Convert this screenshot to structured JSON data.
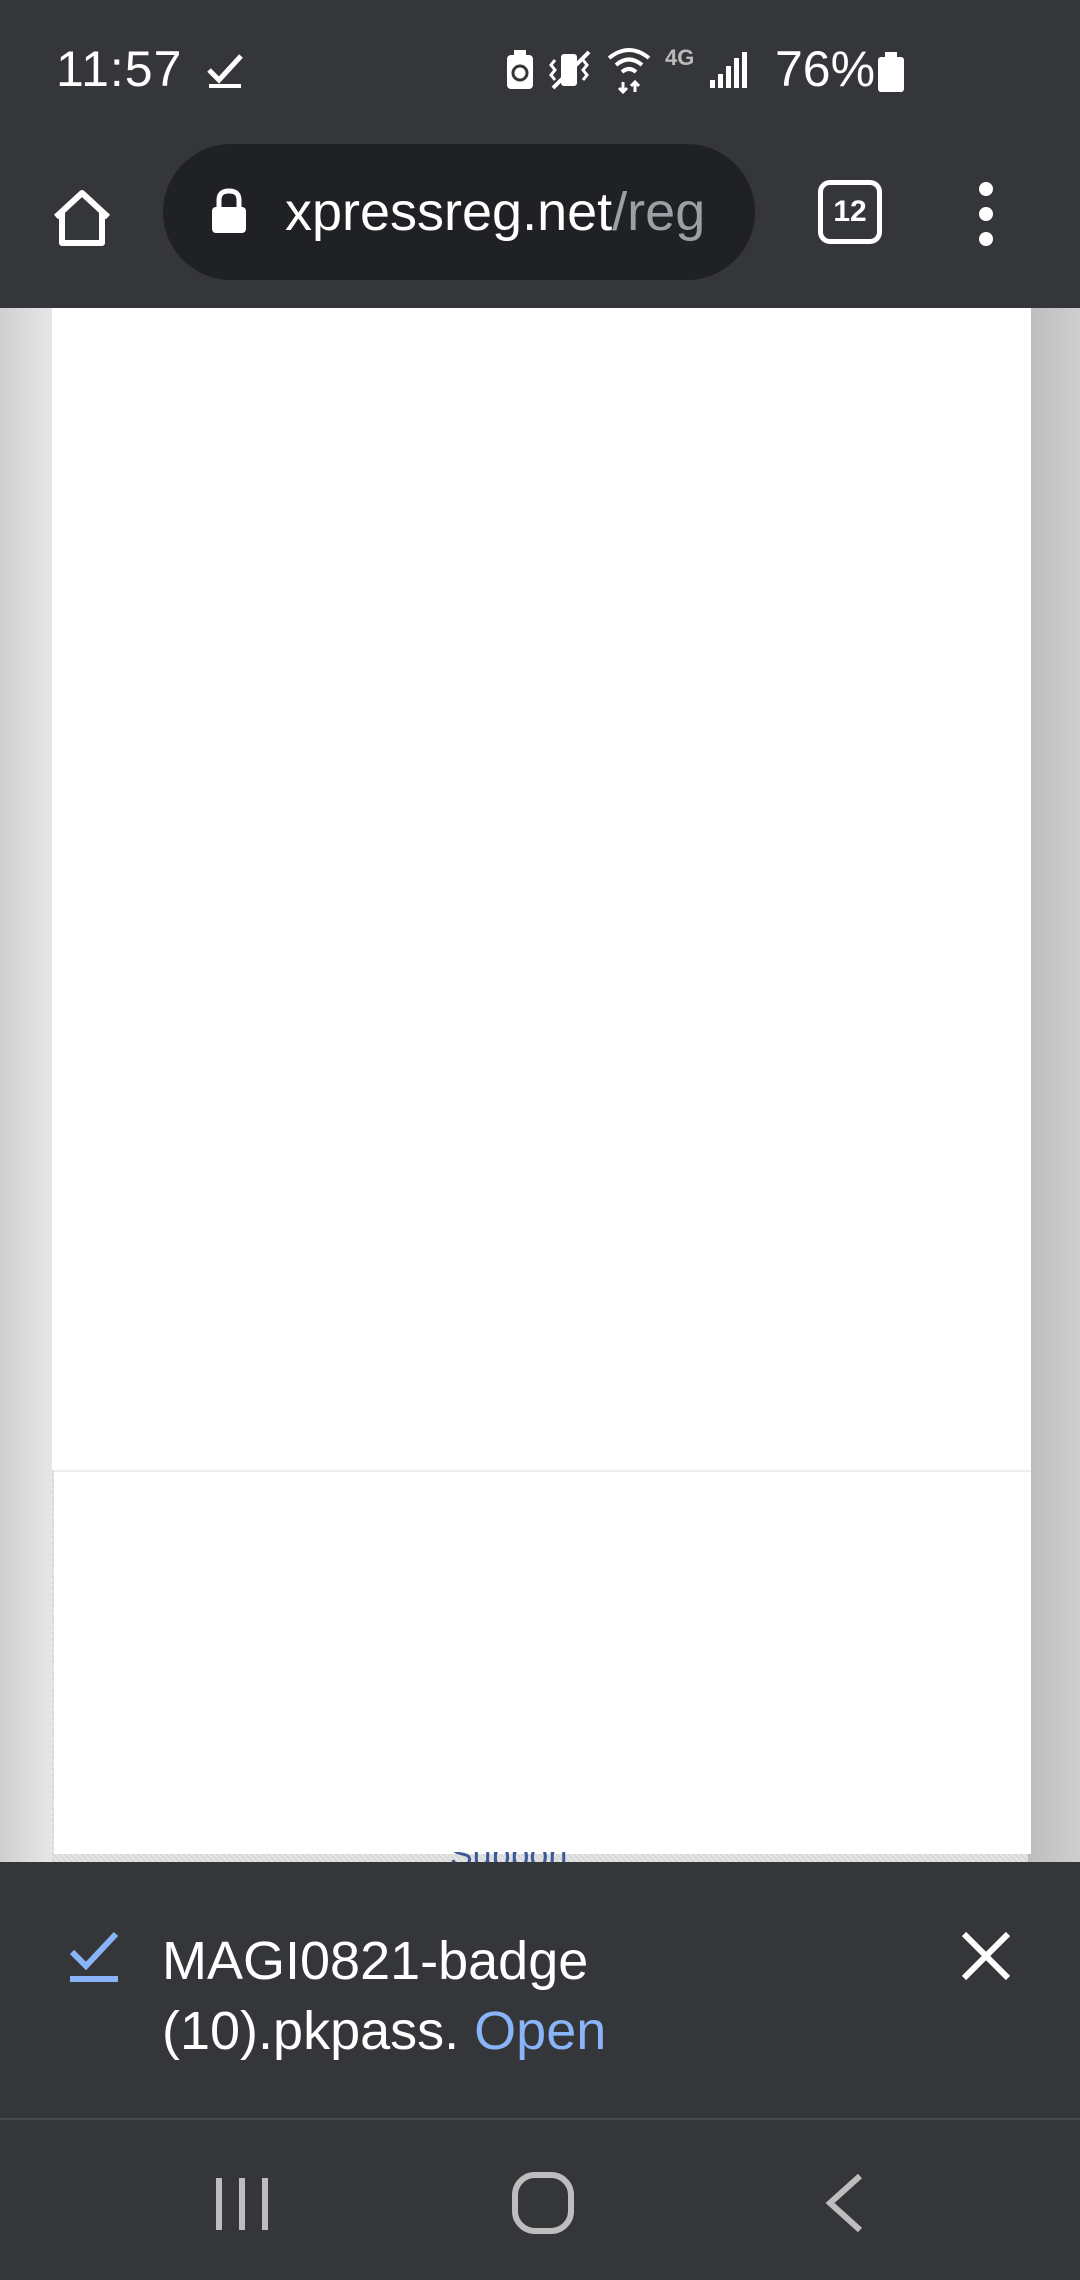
{
  "status_bar": {
    "time": "11:57",
    "battery_percent": "76%",
    "network_label": "4G",
    "icons": [
      "download-done-icon",
      "battery-saver-icon",
      "vibrate-icon",
      "wifi-icon",
      "signal-icon",
      "battery-icon"
    ]
  },
  "toolbar": {
    "url_host": "xpressreg.net",
    "url_path": "/reg",
    "tab_count": "12",
    "icons": [
      "home-icon",
      "lock-icon",
      "menu-icon"
    ]
  },
  "web_page": {
    "link_peek_text": "Support"
  },
  "download_bar": {
    "filename_line1": "MAGI0821-badge",
    "filename_line2": "(10).pkpass.",
    "open_label": "Open",
    "accent_color": "#8ab4f8"
  },
  "nav_bar": {
    "icons": [
      "recents-icon",
      "home-circle-icon",
      "back-icon"
    ]
  }
}
